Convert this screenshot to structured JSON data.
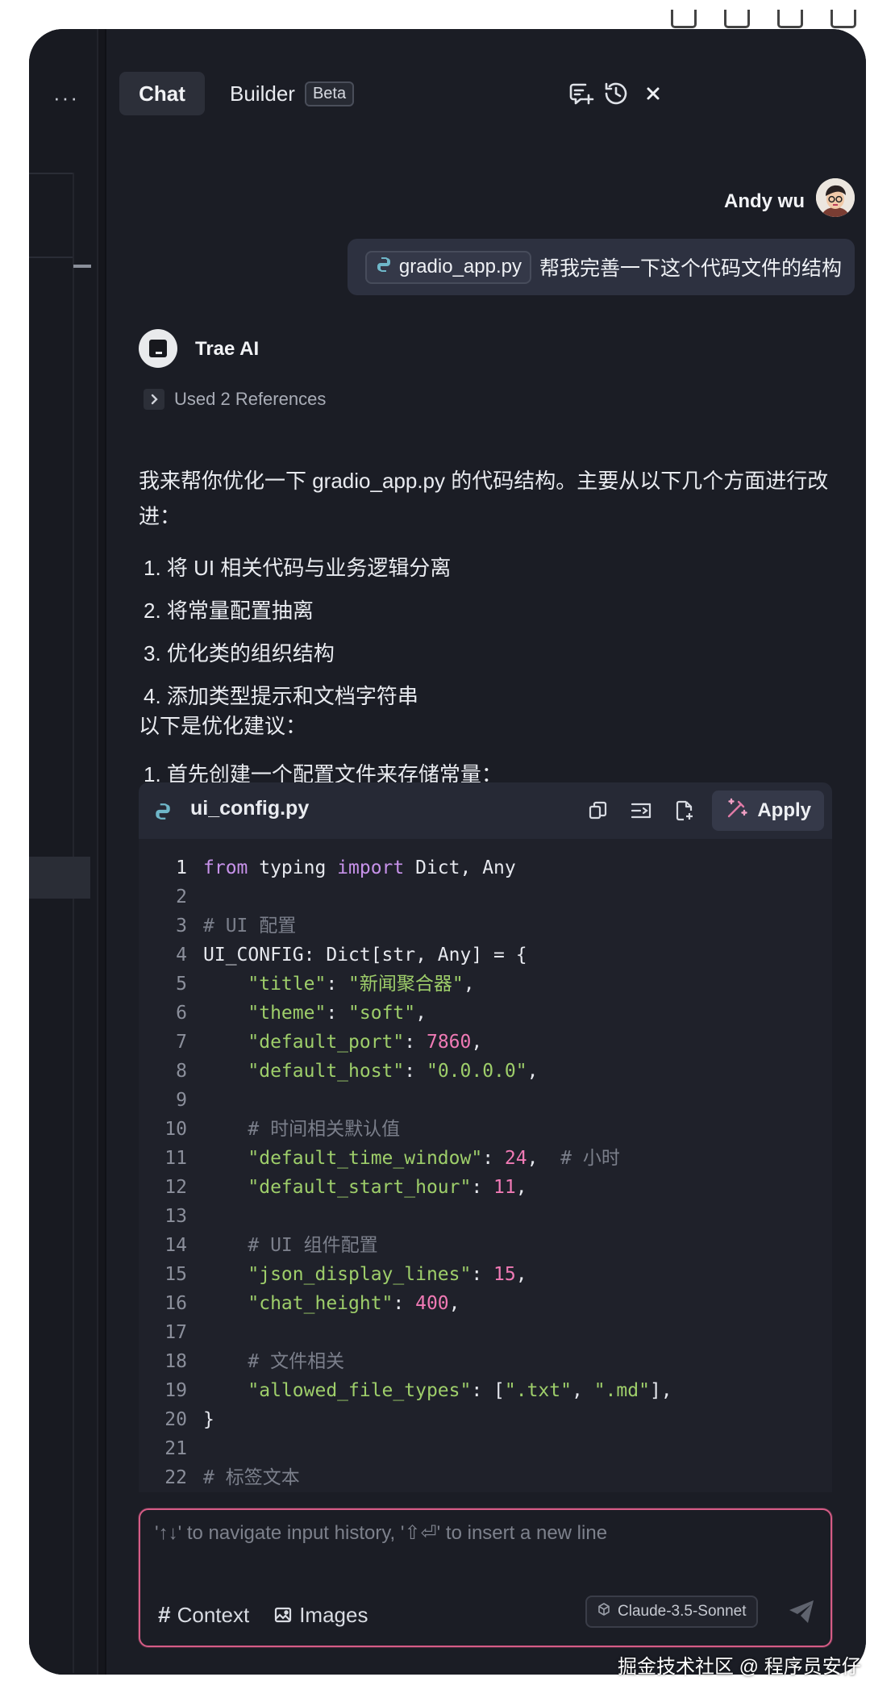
{
  "header": {
    "tab_chat": "Chat",
    "tab_builder": "Builder",
    "builder_badge": "Beta",
    "icons": [
      "new-chat-icon",
      "history-icon",
      "close-icon"
    ]
  },
  "user_message": {
    "name": "Andy wu",
    "file_chip": "gradio_app.py",
    "text": "帮我完善一下这个代码文件的结构"
  },
  "ai_message": {
    "name": "Trae AI",
    "references": "Used 2 References",
    "intro": "我来帮你优化一下 gradio_app.py 的代码结构。主要从以下几个方面进行改进：",
    "points": [
      "1. 将 UI 相关代码与业务逻辑分离",
      "2. 将常量配置抽离",
      "3. 优化类的组织结构",
      "4. 添加类型提示和文档字符串"
    ],
    "suggestion_title": "以下是优化建议：",
    "step1": "1. 首先创建一个配置文件来存储常量："
  },
  "code_block": {
    "filename": "ui_config.py",
    "apply_label": "Apply",
    "colors": {
      "keyword": "#c792ea",
      "string": "#9ece6a",
      "number": "#f07ab5",
      "comment": "#7b7f8b",
      "plain": "#e6e8ee"
    },
    "lines": [
      {
        "n": "1",
        "tokens": [
          [
            "from",
            "keyword"
          ],
          [
            " typing ",
            "plain"
          ],
          [
            "import",
            "keyword"
          ],
          [
            " Dict, Any",
            "plain"
          ]
        ]
      },
      {
        "n": "2",
        "tokens": []
      },
      {
        "n": "3",
        "tokens": [
          [
            "# UI 配置",
            "comment"
          ]
        ]
      },
      {
        "n": "4",
        "tokens": [
          [
            "UI_CONFIG: Dict[str, Any] = {",
            "plain"
          ]
        ]
      },
      {
        "n": "5",
        "tokens": [
          [
            "    ",
            "plain"
          ],
          [
            "\"title\"",
            "string"
          ],
          [
            ": ",
            "plain"
          ],
          [
            "\"新闻聚合器\"",
            "string"
          ],
          [
            ",",
            "plain"
          ]
        ]
      },
      {
        "n": "6",
        "tokens": [
          [
            "    ",
            "plain"
          ],
          [
            "\"theme\"",
            "string"
          ],
          [
            ": ",
            "plain"
          ],
          [
            "\"soft\"",
            "string"
          ],
          [
            ",",
            "plain"
          ]
        ]
      },
      {
        "n": "7",
        "tokens": [
          [
            "    ",
            "plain"
          ],
          [
            "\"default_port\"",
            "string"
          ],
          [
            ": ",
            "plain"
          ],
          [
            "7860",
            "number"
          ],
          [
            ",",
            "plain"
          ]
        ]
      },
      {
        "n": "8",
        "tokens": [
          [
            "    ",
            "plain"
          ],
          [
            "\"default_host\"",
            "string"
          ],
          [
            ": ",
            "plain"
          ],
          [
            "\"0.0.0.0\"",
            "string"
          ],
          [
            ",",
            "plain"
          ]
        ]
      },
      {
        "n": "9",
        "tokens": []
      },
      {
        "n": "10",
        "tokens": [
          [
            "    ",
            "plain"
          ],
          [
            "# 时间相关默认值",
            "comment"
          ]
        ]
      },
      {
        "n": "11",
        "tokens": [
          [
            "    ",
            "plain"
          ],
          [
            "\"default_time_window\"",
            "string"
          ],
          [
            ": ",
            "plain"
          ],
          [
            "24",
            "number"
          ],
          [
            ",  ",
            "plain"
          ],
          [
            "# 小时",
            "comment"
          ]
        ]
      },
      {
        "n": "12",
        "tokens": [
          [
            "    ",
            "plain"
          ],
          [
            "\"default_start_hour\"",
            "string"
          ],
          [
            ": ",
            "plain"
          ],
          [
            "11",
            "number"
          ],
          [
            ",",
            "plain"
          ]
        ]
      },
      {
        "n": "13",
        "tokens": []
      },
      {
        "n": "14",
        "tokens": [
          [
            "    ",
            "plain"
          ],
          [
            "# UI 组件配置",
            "comment"
          ]
        ]
      },
      {
        "n": "15",
        "tokens": [
          [
            "    ",
            "plain"
          ],
          [
            "\"json_display_lines\"",
            "string"
          ],
          [
            ": ",
            "plain"
          ],
          [
            "15",
            "number"
          ],
          [
            ",",
            "plain"
          ]
        ]
      },
      {
        "n": "16",
        "tokens": [
          [
            "    ",
            "plain"
          ],
          [
            "\"chat_height\"",
            "string"
          ],
          [
            ": ",
            "plain"
          ],
          [
            "400",
            "number"
          ],
          [
            ",",
            "plain"
          ]
        ]
      },
      {
        "n": "17",
        "tokens": []
      },
      {
        "n": "18",
        "tokens": [
          [
            "    ",
            "plain"
          ],
          [
            "# 文件相关",
            "comment"
          ]
        ]
      },
      {
        "n": "19",
        "tokens": [
          [
            "    ",
            "plain"
          ],
          [
            "\"allowed_file_types\"",
            "string"
          ],
          [
            ": [",
            "plain"
          ],
          [
            "\".txt\"",
            "string"
          ],
          [
            ", ",
            "plain"
          ],
          [
            "\".md\"",
            "string"
          ],
          [
            "],",
            "plain"
          ]
        ]
      },
      {
        "n": "20",
        "tokens": [
          [
            "}",
            "plain"
          ]
        ]
      },
      {
        "n": "21",
        "tokens": []
      },
      {
        "n": "22",
        "tokens": [
          [
            "# 标签文本",
            "comment"
          ]
        ]
      }
    ]
  },
  "input": {
    "placeholder": "'↑↓' to navigate input history, '⇧⏎' to insert a new line",
    "context_label": "Context",
    "images_label": "Images",
    "model": "Claude-3.5-Sonnet"
  },
  "watermark": "掘金技术社区 @ 程序员安仔"
}
